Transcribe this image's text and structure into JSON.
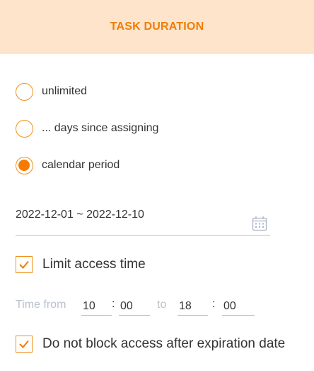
{
  "header": {
    "title": "TASK DURATION"
  },
  "duration_options": [
    {
      "label": "unlimited",
      "checked": false
    },
    {
      "label": "... days since assigning",
      "checked": false
    },
    {
      "label": "calendar period",
      "checked": true
    }
  ],
  "date_range": {
    "value": "2022-12-01 ~ 2022-12-10"
  },
  "limit_access": {
    "label": "Limit access time",
    "checked": true
  },
  "time": {
    "from_label": "Time from",
    "from_hour": "10",
    "from_minute": "00",
    "to_label": "to",
    "to_hour": "18",
    "to_minute": "00",
    "separator": ":"
  },
  "no_block": {
    "label": "Do not block access after expiration date",
    "checked": true
  },
  "colors": {
    "accent": "#f47a00",
    "header_bg": "#fde4cb",
    "muted": "#b9c0cf"
  }
}
